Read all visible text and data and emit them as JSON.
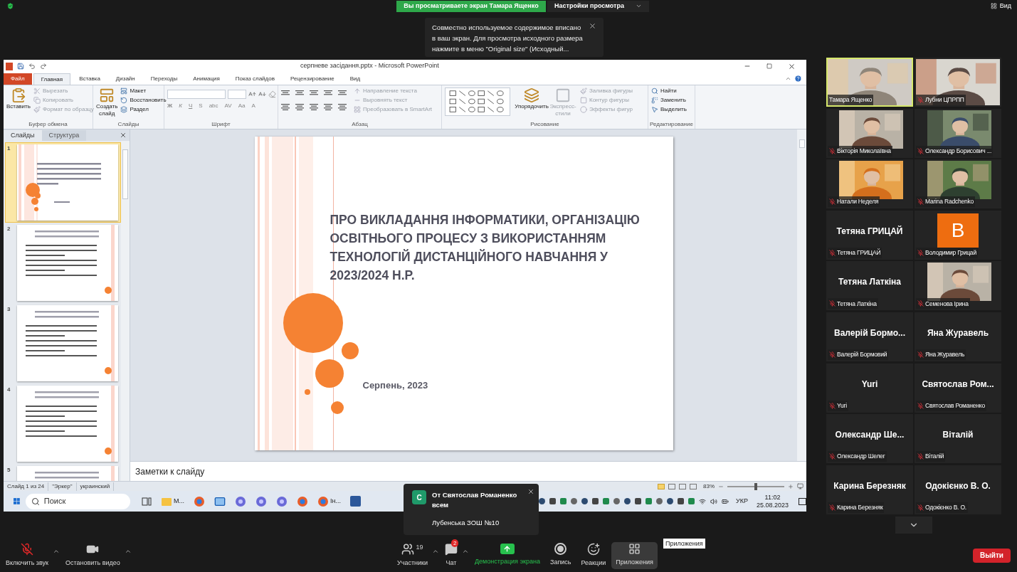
{
  "top_bar": {
    "sharing_banner": "Вы просматриваете экран Тамара Ященко",
    "view_options": "Настройки просмотра",
    "view_button": "Вид"
  },
  "notice": {
    "text": "Совместно используемое содержимое вписано в ваш экран. Для просмотра исходного размера нажмите в меню \"Original size\" (Исходный..."
  },
  "powerpoint": {
    "title": "серпневе засідання.pptx - Microsoft PowerPoint",
    "tabs": [
      {
        "label": "Файл",
        "kind": "file",
        "selected": false
      },
      {
        "label": "Главная",
        "kind": "tab",
        "selected": true
      },
      {
        "label": "Вставка",
        "kind": "tab",
        "selected": false
      },
      {
        "label": "Дизайн",
        "kind": "tab",
        "selected": false
      },
      {
        "label": "Переходы",
        "kind": "tab",
        "selected": false
      },
      {
        "label": "Анимация",
        "kind": "tab",
        "selected": false
      },
      {
        "label": "Показ слайдов",
        "kind": "tab",
        "selected": false
      },
      {
        "label": "Рецензирование",
        "kind": "tab",
        "selected": false
      },
      {
        "label": "Вид",
        "kind": "tab",
        "selected": false
      }
    ],
    "ribbon": [
      {
        "kind": "clipboard",
        "label": "Буфер обмена",
        "commands": [
          {
            "label": "Вставить",
            "kind": "large",
            "disabled": false
          },
          {
            "label": "Вырезать",
            "kind": "small",
            "disabled": true
          },
          {
            "label": "Копировать",
            "kind": "small",
            "disabled": true
          },
          {
            "label": "Формат по образцу",
            "kind": "small",
            "disabled": true
          }
        ]
      },
      {
        "kind": "slides",
        "label": "Слайды",
        "commands": [
          {
            "label": "Создать слайд",
            "kind": "large",
            "disabled": false
          },
          {
            "label": "Макет",
            "kind": "small",
            "disabled": false
          },
          {
            "label": "Восстановить",
            "kind": "small",
            "disabled": false
          },
          {
            "label": "Раздел",
            "kind": "small",
            "disabled": false
          }
        ]
      },
      {
        "kind": "font",
        "label": "Шрифт",
        "glyphs": [
          "Ж",
          "К",
          "Ч",
          "S",
          "abc",
          "AV",
          "Aa",
          "A"
        ]
      },
      {
        "kind": "paragraph",
        "label": "Абзац",
        "commands": [
          {
            "label": "Направление текста",
            "kind": "small",
            "disabled": true
          },
          {
            "label": "Выровнять текст",
            "kind": "small",
            "disabled": true
          },
          {
            "label": "Преобразовать в SmartArt",
            "kind": "small",
            "disabled": true
          }
        ]
      },
      {
        "kind": "drawing",
        "label": "Рисование",
        "commands": [
          {
            "label": "Упорядочить",
            "kind": "large",
            "disabled": false
          },
          {
            "label": "Экспресс-стили",
            "kind": "large",
            "disabled": true
          },
          {
            "label": "Заливка фигуры",
            "kind": "small",
            "disabled": true
          },
          {
            "label": "Контур фигуры",
            "kind": "small",
            "disabled": true
          },
          {
            "label": "Эффекты фигур",
            "kind": "small",
            "disabled": true
          }
        ]
      },
      {
        "kind": "editing",
        "label": "Редактирование",
        "commands": [
          {
            "label": "Найти",
            "kind": "small",
            "disabled": false
          },
          {
            "label": "Заменить",
            "kind": "small",
            "disabled": false
          },
          {
            "label": "Выделить",
            "kind": "small",
            "disabled": false
          }
        ]
      }
    ],
    "pane_tabs": [
      {
        "label": "Слайды",
        "selected": true
      },
      {
        "label": "Структура",
        "selected": false
      }
    ],
    "thumbnails": [
      {
        "number": "1",
        "kind": "title",
        "selected": true
      },
      {
        "number": "2",
        "kind": "content",
        "selected": false
      },
      {
        "number": "3",
        "kind": "content",
        "selected": false
      },
      {
        "number": "4",
        "kind": "content",
        "selected": false
      },
      {
        "number": "5",
        "kind": "content",
        "selected": false
      }
    ],
    "slide": {
      "title": "ПРО ВИКЛАДАННЯ ІНФОРМАТИКИ, ОРГАНІЗАЦІЮ ОСВІТНЬОГО ПРОЦЕСУ З ВИКОРИСТАННЯМ ТЕХНОЛОГІЙ ДИСТАНЦІЙНОГО НАВЧАННЯ У 2023/2024 Н.Р.",
      "subtitle": "Серпень, 2023"
    },
    "notes_placeholder": "Заметки к слайду",
    "status": {
      "items": [
        "Слайд 1 из 24",
        "\"Эркер\"",
        "украинский"
      ],
      "zoom": "83%",
      "zoom_slider": {
        "level": 0.5
      }
    }
  },
  "taskbar": {
    "search_placeholder": "Поиск",
    "apps": [
      {
        "kind": "taskview"
      },
      {
        "kind": "folder",
        "label": "М..."
      },
      {
        "kind": "browser"
      },
      {
        "kind": "mail"
      },
      {
        "kind": "app"
      },
      {
        "kind": "app"
      },
      {
        "kind": "app"
      },
      {
        "kind": "browser"
      },
      {
        "kind": "browser",
        "label": "Ін..."
      },
      {
        "kind": "word"
      }
    ],
    "language": "УКР",
    "time": "11:02",
    "date": "25.08.2023"
  },
  "notification": {
    "avatar": "С",
    "from": "От Святослав Романенко",
    "to": "всем",
    "message": "Лубенська ЗОШ №10"
  },
  "participants": [
    {
      "name": "Тамара Ященко",
      "kind": "wide_video",
      "muted": false,
      "speaking": true
    },
    {
      "name": "Лубни ЦПРПП",
      "kind": "wide_video",
      "muted": true,
      "speaking": false
    },
    {
      "name": "Вікторія Миколаївна",
      "kind": "video",
      "muted": true,
      "speaking": false
    },
    {
      "name": "Олександр Борисович ...",
      "kind": "video",
      "muted": true,
      "speaking": false
    },
    {
      "name": "Натали Неделя",
      "kind": "video",
      "muted": true,
      "speaking": false
    },
    {
      "name": "Marina Radchenko",
      "kind": "video",
      "muted": true,
      "speaking": false
    },
    {
      "name": "Тетяна ГРИЦАЙ",
      "kind": "name",
      "big_label": "Тетяна ГРИЦАЙ",
      "muted": true,
      "speaking": false
    },
    {
      "name": "Володимир Грицай",
      "kind": "avatar",
      "avatar": "B",
      "muted": true,
      "speaking": false
    },
    {
      "name": "Тетяна Латкіна",
      "kind": "name",
      "big_label": "Тетяна Латкіна",
      "muted": true,
      "speaking": false
    },
    {
      "name": "Семенова Ірина",
      "kind": "video",
      "muted": true,
      "speaking": false
    },
    {
      "name": "Валерій Бормовий",
      "kind": "name",
      "big_label": "Валерій Бормо...",
      "muted": true,
      "speaking": false
    },
    {
      "name": "Яна Журавель",
      "kind": "name",
      "big_label": "Яна Журавель",
      "muted": true,
      "speaking": false
    },
    {
      "name": "Yuri",
      "kind": "name",
      "big_label": "Yuri",
      "muted": true,
      "speaking": false
    },
    {
      "name": "Святослав Романенко",
      "kind": "name",
      "big_label": "Святослав Ром...",
      "muted": true,
      "speaking": false
    },
    {
      "name": "Олександр Шелег",
      "kind": "name",
      "big_label": "Олександр Ше...",
      "muted": true,
      "speaking": false
    },
    {
      "name": "Віталій",
      "kind": "name",
      "big_label": "Віталій",
      "muted": true,
      "speaking": false
    },
    {
      "name": "Карина Березняк",
      "kind": "name",
      "big_label": "Карина Березняк",
      "muted": true,
      "speaking": false
    },
    {
      "name": "Одокієнко В. О.",
      "kind": "name",
      "big_label": "Одокієнко В. О.",
      "muted": true,
      "speaking": false
    }
  ],
  "toolbar": {
    "items": [
      {
        "kind": "mic",
        "label": "Включить звук",
        "muted": true,
        "selected": false
      },
      {
        "kind": "video",
        "label": "Остановить видео",
        "selected": false
      },
      {
        "kind": "participants",
        "label": "Участники",
        "count": "19",
        "selected": false
      },
      {
        "kind": "chat",
        "label": "Чат",
        "badge": "2",
        "selected": false
      },
      {
        "kind": "share",
        "label": "Демонстрация экрана",
        "selected": false
      },
      {
        "kind": "record",
        "label": "Запись",
        "selected": false
      },
      {
        "kind": "reactions",
        "label": "Реакции",
        "selected": false
      },
      {
        "kind": "apps",
        "label": "Приложения",
        "selected": true
      }
    ],
    "tooltip": "Приложения",
    "leave": "Выйти"
  }
}
